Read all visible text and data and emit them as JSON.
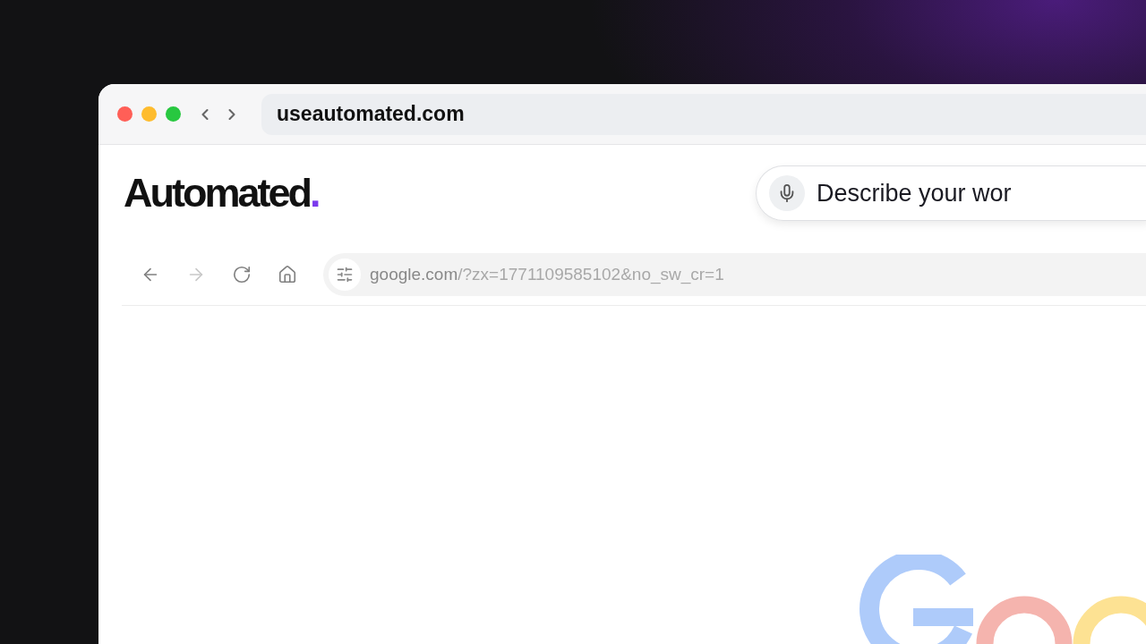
{
  "browser": {
    "address": "useautomated.com"
  },
  "app": {
    "logo": {
      "name": "Automated",
      "mark": "."
    },
    "prompt": {
      "placeholder": "Describe your wor"
    }
  },
  "inner_toolbar": {
    "buttons": [
      {
        "kind": "back",
        "disabled": false
      },
      {
        "kind": "forward",
        "disabled": true
      },
      {
        "kind": "reload",
        "disabled": false
      },
      {
        "kind": "home",
        "disabled": false
      }
    ],
    "address": {
      "host": "google.com",
      "rest": "/?zx=1771109585102&no_sw_cr=1"
    }
  }
}
